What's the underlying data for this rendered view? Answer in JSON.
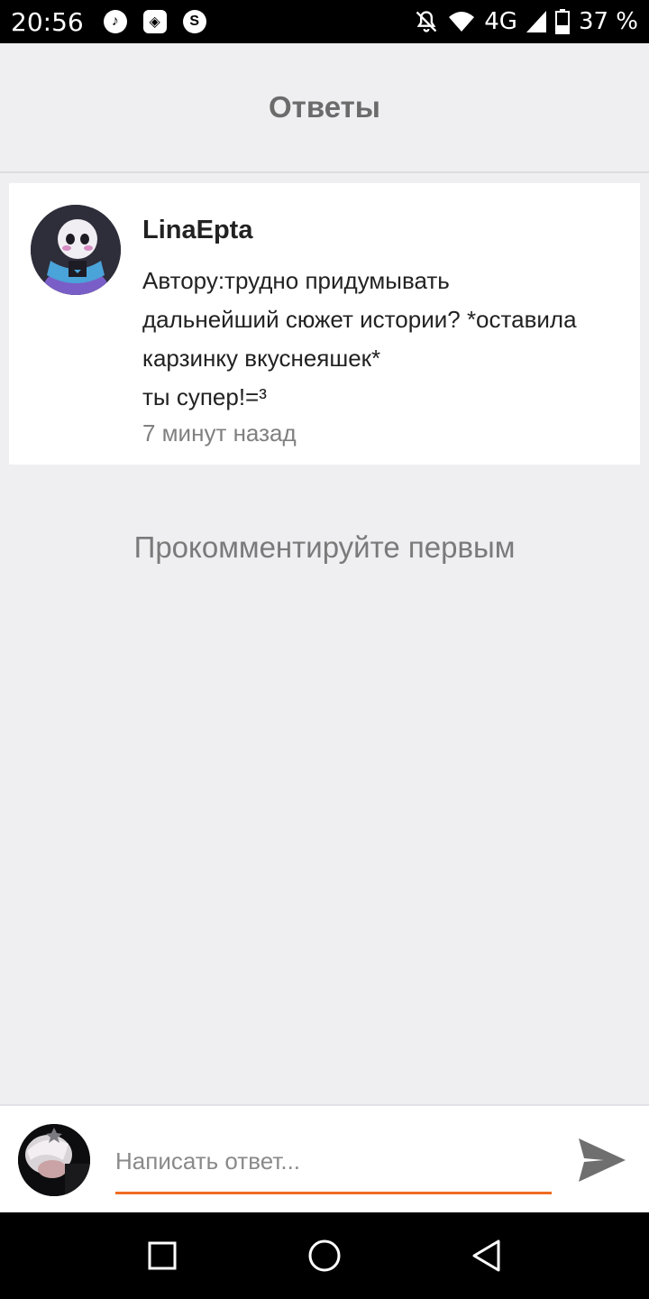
{
  "status_bar": {
    "time": "20:56",
    "network": "4G",
    "battery": "37 %",
    "icons": [
      "music-icon",
      "lion-app-icon",
      "shazam-icon",
      "bell-off-icon",
      "wifi-icon",
      "signal-icon",
      "battery-icon"
    ]
  },
  "header": {
    "title": "Ответы"
  },
  "comment": {
    "author": "LinaEpta",
    "text": "Автору:трудно придумывать\nдальнейший сюжет истории? *оставила\nкарзинку вкуснеяшек*\nты супер!=³",
    "time": "7 минут назад"
  },
  "empty_message": "Прокомментируйте первым",
  "reply": {
    "placeholder": "Написать ответ..."
  },
  "colors": {
    "accent": "#f06c22",
    "background": "#efeef1"
  }
}
